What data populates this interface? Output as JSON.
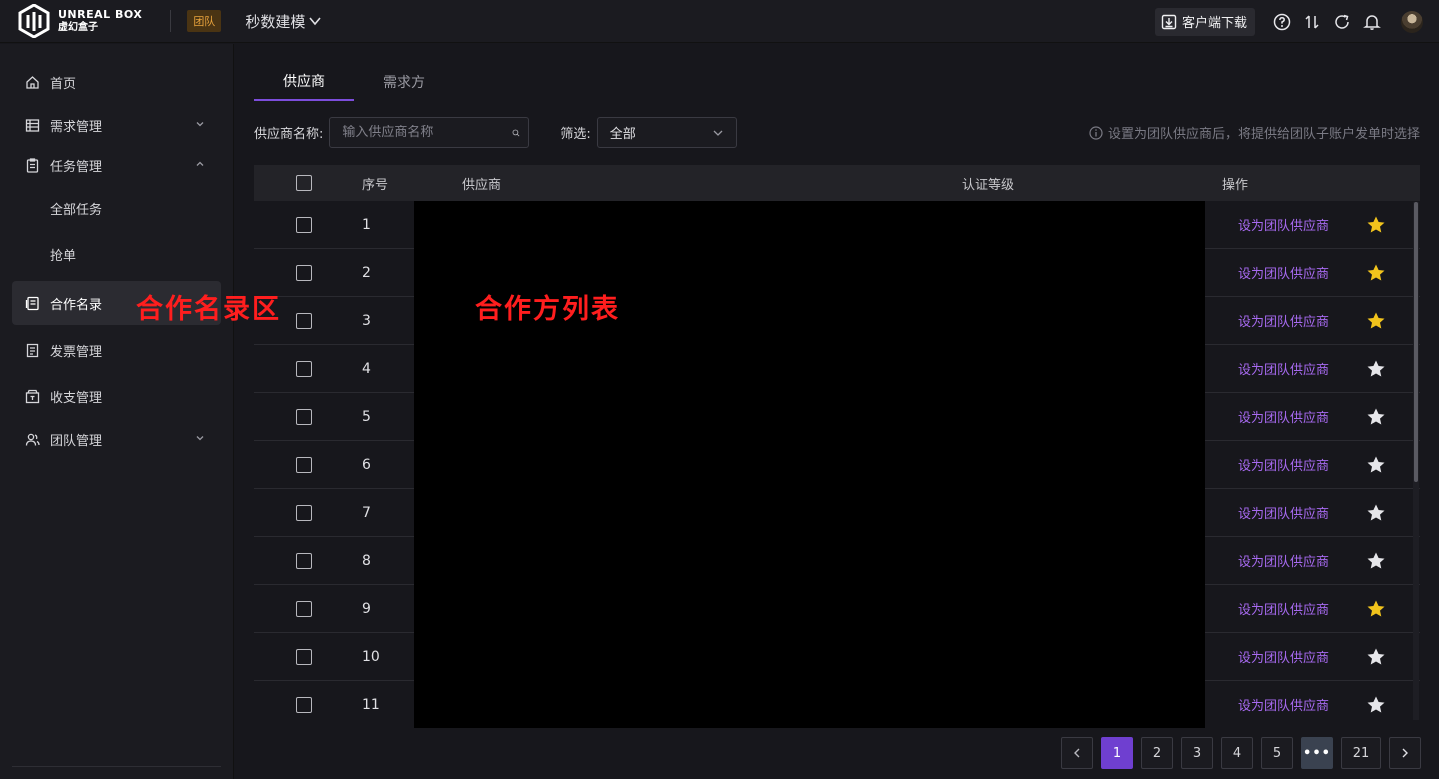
{
  "topbar": {
    "logo_en": "UNREAL BOX",
    "logo_cn": "虚幻盒子",
    "team_badge": "团队",
    "project": "秒数建模",
    "download_label": "客户端下载"
  },
  "sidebar": {
    "items": [
      {
        "label": "首页",
        "icon": "home-icon"
      },
      {
        "label": "需求管理",
        "icon": "table-icon"
      },
      {
        "label": "任务管理",
        "icon": "clipboard-icon"
      },
      {
        "label": "全部任务"
      },
      {
        "label": "抢单"
      },
      {
        "label": "合作名录",
        "icon": "book-icon"
      },
      {
        "label": "发票管理",
        "icon": "receipt-icon"
      },
      {
        "label": "收支管理",
        "icon": "wallet-icon"
      },
      {
        "label": "团队管理",
        "icon": "users-icon"
      }
    ]
  },
  "annotations": {
    "sidebar_note": "合作名录区",
    "list_note": "合作方列表"
  },
  "main": {
    "tabs": [
      "供应商",
      "需求方"
    ],
    "filter": {
      "name_label": "供应商名称:",
      "search_placeholder": "输入供应商名称",
      "filter_label": "筛选:",
      "filter_value": "全部",
      "hint": "设置为团队供应商后，将提供给团队子账户发单时选择"
    },
    "table": {
      "headers": {
        "index": "序号",
        "supplier": "供应商",
        "level": "认证等级",
        "action": "操作"
      },
      "action_label": "设为团队供应商",
      "rows": [
        {
          "index": "1",
          "starred": true
        },
        {
          "index": "2",
          "starred": true
        },
        {
          "index": "3",
          "starred": true
        },
        {
          "index": "4",
          "starred": false
        },
        {
          "index": "5",
          "starred": false
        },
        {
          "index": "6",
          "starred": false
        },
        {
          "index": "7",
          "starred": false
        },
        {
          "index": "8",
          "starred": false
        },
        {
          "index": "9",
          "starred": true
        },
        {
          "index": "10",
          "starred": false
        },
        {
          "index": "11",
          "starred": false
        }
      ]
    },
    "pagination": {
      "pages": [
        "1",
        "2",
        "3",
        "4",
        "5",
        "•••",
        "21"
      ],
      "current": "1"
    }
  },
  "colors": {
    "accent": "#6f3fd0",
    "link": "#a76af0",
    "star_on": "#f2c41c",
    "star_off": "#e6e6ea",
    "team_badge": "#e8a33d",
    "annotation": "#ff1e1e"
  }
}
